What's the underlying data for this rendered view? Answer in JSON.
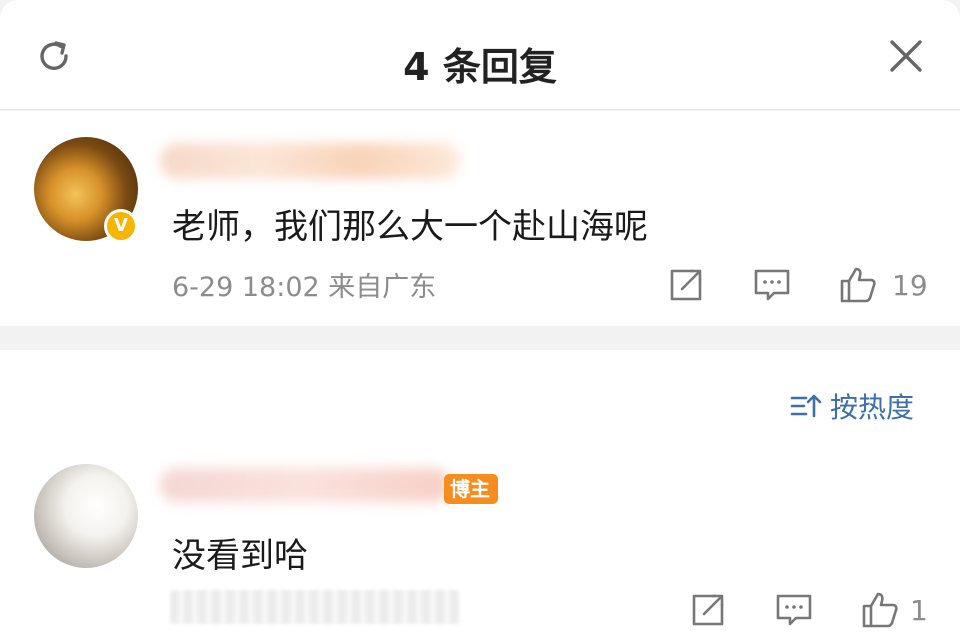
{
  "header": {
    "title": "4 条回复",
    "refresh_icon": "refresh-icon",
    "close_icon": "close-icon"
  },
  "root_comment": {
    "text": "老师，我们那么大一个赴山海呢",
    "meta": "6-29 18:02  来自广东",
    "verified_badge": "V",
    "likes": "19",
    "icons": [
      "share-icon",
      "comment-icon",
      "like-icon"
    ]
  },
  "sort": {
    "label": "按热度",
    "icon": "sort-icon"
  },
  "reply": {
    "tag": "博主",
    "text": "没看到哈",
    "likes": "1",
    "icons": [
      "share-icon",
      "comment-icon",
      "like-icon"
    ]
  },
  "colors": {
    "link_blue": "#3d6fa8",
    "meta_gray": "#8c8c8c",
    "blogger_orange": "#f88d1f",
    "verified_yellow": "#f7b500"
  }
}
